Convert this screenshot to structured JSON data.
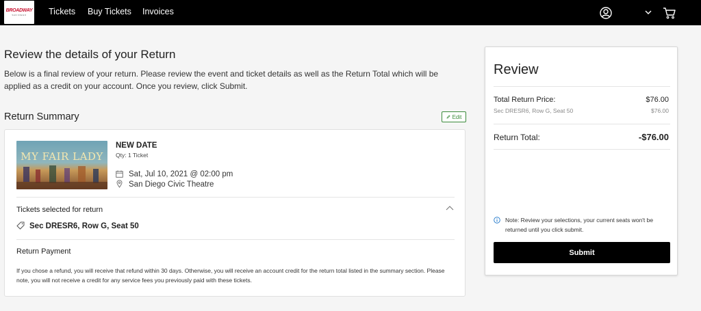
{
  "header": {
    "logo_line1": "BROADWAY",
    "logo_line2": "SAN DIEGO",
    "nav": [
      "Tickets",
      "Buy Tickets",
      "Invoices"
    ],
    "icons": [
      "user-icon",
      "chevron-down-icon",
      "cart-icon"
    ]
  },
  "page": {
    "title": "Review the details of your Return",
    "intro": "Below is a final review of your return. Please review the event and ticket details as well as the Return Total which will be applied as a credit on your account. Once you review, click Submit."
  },
  "summary": {
    "title": "Return Summary",
    "edit_label": "Edit",
    "event": {
      "poster_title": "MY FAIR LADY",
      "status": "NEW DATE",
      "qty": "Qty: 1 Ticket",
      "datetime": "Sat, Jul 10, 2021 @ 02:00 pm",
      "venue": "San Diego Civic Theatre"
    },
    "tickets_heading": "Tickets selected for return",
    "seat": "Sec DRESR6, Row G, Seat 50",
    "payment_heading": "Return Payment",
    "payment_text": "If you chose a refund, you will receive that refund within 30 days. Otherwise, you will receive an account credit for the return total listed in the summary section. Please note, you will not receive a credit for any service fees you previously paid with these tickets."
  },
  "review": {
    "title": "Review",
    "total_price_label": "Total Return Price:",
    "total_price_value": "$76.00",
    "seat_line": "Sec DRESR6, Row G, Seat 50",
    "seat_price": "$76.00",
    "return_total_label": "Return Total:",
    "return_total_value": "-$76.00",
    "note": "Note: Review your selections, your current seats won't be returned until you click submit.",
    "submit_label": "Submit"
  },
  "colors": {
    "topbar": "#000000",
    "accent_green": "#3a8a3a",
    "brand_red": "#c8102e",
    "info_blue": "#1a73c8"
  }
}
